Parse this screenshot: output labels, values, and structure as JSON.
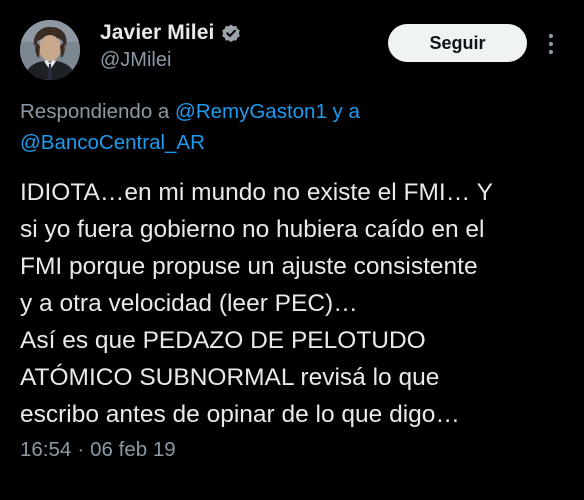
{
  "author": {
    "display_name": "Javier Milei",
    "handle": "@JMilei",
    "verified": true,
    "avatar_icon": "profile-photo"
  },
  "actions": {
    "follow_label": "Seguir",
    "more_icon": "more-vertical-icon"
  },
  "reply_context": {
    "prefix": "Respondiendo a ",
    "mention_1": "@RemyGaston1",
    "connector": " y a",
    "mention_2": "@BancoCentral_AR"
  },
  "tweet": {
    "lines": [
      "IDIOTA…en mi mundo no existe el FMI… Y",
      "si yo fuera gobierno no hubiera caído en el",
      "FMI porque propuse un ajuste consistente",
      "y a otra velocidad (leer PEC)…",
      "Así es que PEDAZO DE PELOTUDO",
      "ATÓMICO SUBNORMAL revisá lo que",
      "escribo antes de opinar de lo que digo…"
    ]
  },
  "meta": {
    "time": "16:54",
    "separator": "·",
    "date": "06 feb 19"
  },
  "colors": {
    "background": "#000000",
    "text_primary": "#e7e9ea",
    "text_secondary": "#8b98a5",
    "accent": "#1d9bf0",
    "button_bg": "#eff3f4",
    "button_text": "#0f1419"
  }
}
